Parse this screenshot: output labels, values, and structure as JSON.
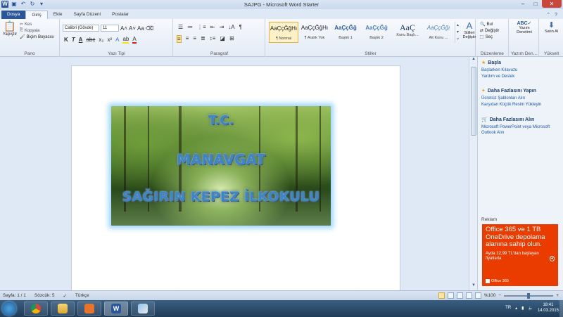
{
  "window": {
    "title": "SAJPG  -  Microsoft Word Starter"
  },
  "tabs": {
    "file": "Dosya",
    "home": "Giriş",
    "insert": "Ekle",
    "layout": "Sayfa Düzeni",
    "mailings": "Postalar"
  },
  "ribbon": {
    "clipboard": {
      "paste": "Yapıştır",
      "cut": "Kes",
      "copy": "Kopyala",
      "format_painter": "Biçim Boyacısı",
      "label": "Pano"
    },
    "font": {
      "name": "Calibri (Gövde)",
      "size": "11",
      "label": "Yazı Tipi"
    },
    "paragraph": {
      "label": "Paragraf"
    },
    "styles": {
      "label": "Stiller",
      "items": [
        {
          "sample": "AaÇçĞğHı",
          "name": "¶ Normal"
        },
        {
          "sample": "AaÇçĞğHı",
          "name": "¶ Aralık Yok"
        },
        {
          "sample": "AaÇçĞğ",
          "name": "Başlık 1"
        },
        {
          "sample": "AaÇçĞğ",
          "name": "Başlık 2"
        },
        {
          "sample": "AaÇ",
          "name": "Konu Başlı..."
        },
        {
          "sample": "AaÇçĞğı",
          "name": "Alt Konu ..."
        }
      ],
      "change_styles": "Stilleri Değiştir"
    },
    "editing": {
      "find": "Bul",
      "replace": "Değiştir",
      "select": "Seç",
      "label": "Düzenleme"
    },
    "proofing": {
      "spelling": "Yazım Denetimi",
      "label": "Yazım Den..."
    },
    "upgrade": {
      "buy": "Satın Al",
      "label": "Yükselt"
    }
  },
  "document": {
    "lines": [
      "T.C.",
      "MANAVGAT",
      "SAĞIRIN KEPEZ İLKOKULU"
    ]
  },
  "pane": {
    "start": {
      "title": "Başla",
      "links": [
        "Başlarken Kılavuzu",
        "Yardım ve Destek"
      ]
    },
    "more": {
      "title": "Daha Fazlasını Yapın",
      "links": [
        "Ücretsiz Şablonları Alın",
        "Karşıdan Küçük Resim Yükleyin"
      ]
    },
    "get": {
      "title": "Daha Fazlasını Alın",
      "links": [
        "Microsoft PowerPoint veya Microsoft Outlook Alın"
      ]
    },
    "ad_label": "Reklam",
    "ad": {
      "headline": "Office 365 ve 1 TB OneDrive depolama alanına sahip olun.",
      "price": "Ayda 12,99 TL'dan başlayan fiyatlarla",
      "brand": "Office 365"
    }
  },
  "status": {
    "page": "Sayfa: 1 / 1",
    "words": "Sözcük: 5",
    "language": "Türkçe",
    "zoom": "%100"
  },
  "taskbar": {
    "lang": "TR",
    "time": "18:41",
    "date": "14.03.2015"
  },
  "colors": {
    "accent": "#2b579a",
    "ad": "#eb3c00"
  }
}
